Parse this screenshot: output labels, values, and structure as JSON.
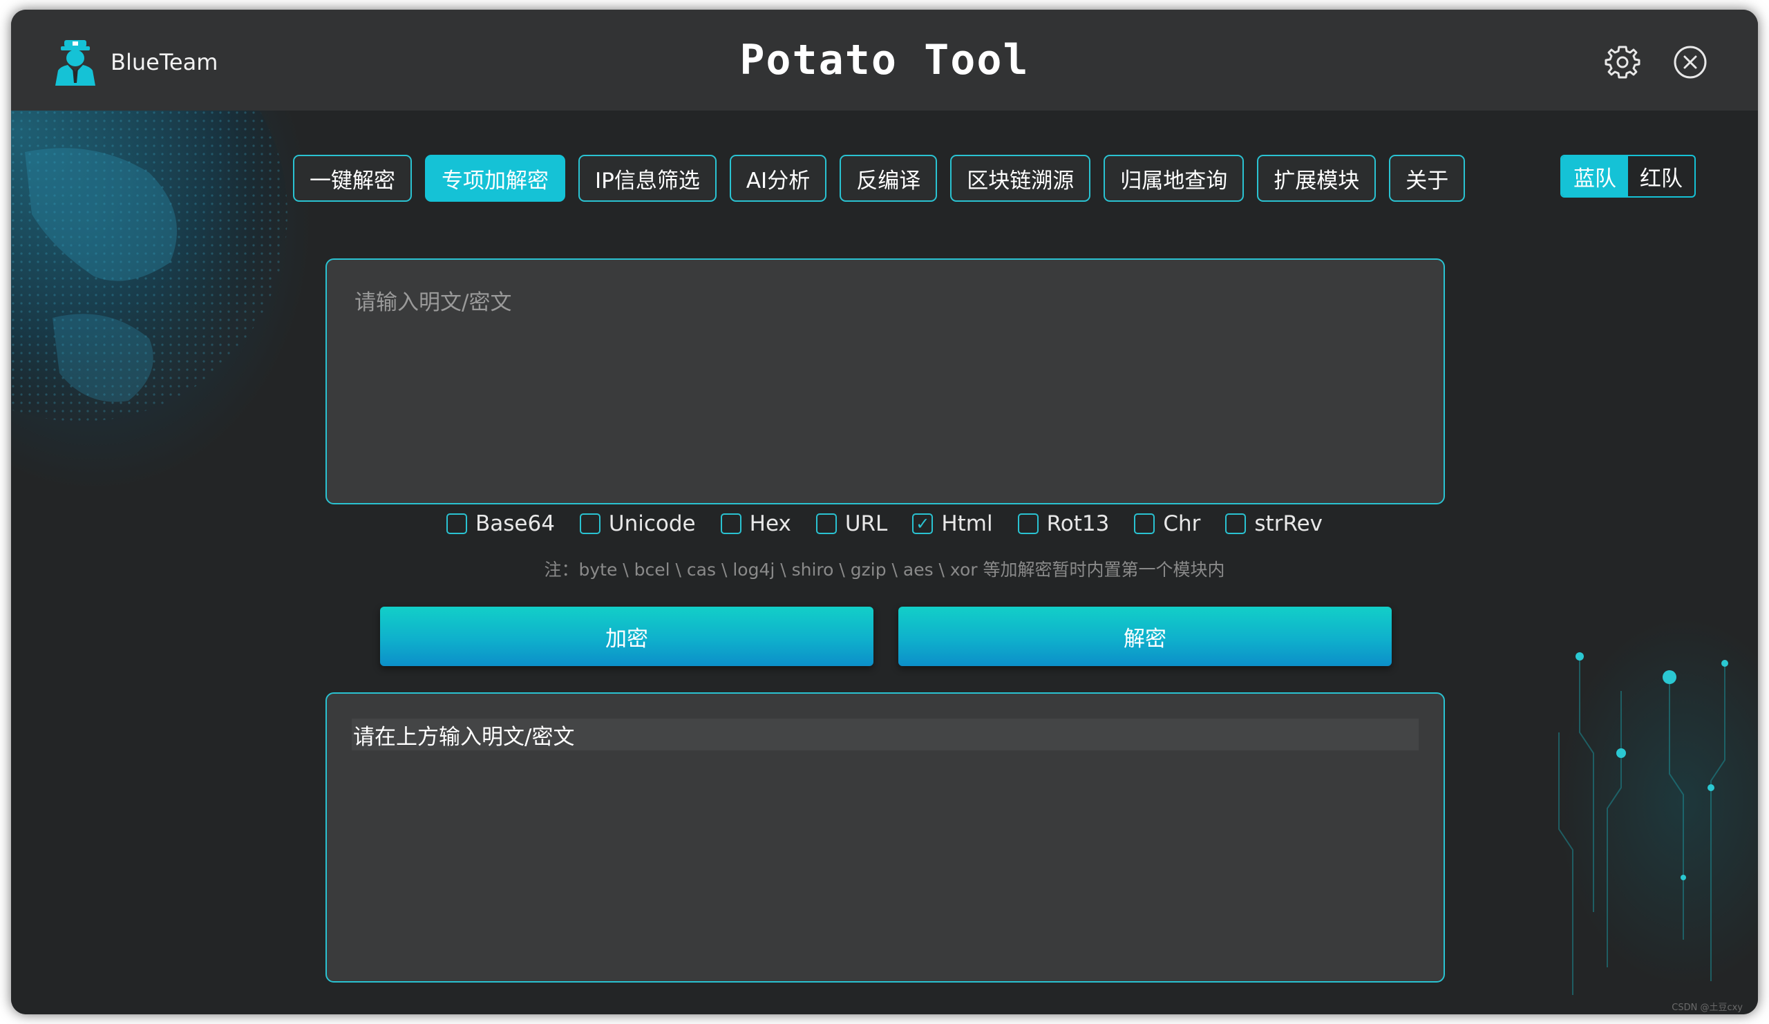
{
  "app": {
    "brand_name": "BlueTeam",
    "title": "Potato Tool",
    "icons": {
      "brand": "officer-avatar-icon",
      "settings": "gear-icon",
      "close": "close-circle-icon"
    }
  },
  "nav": {
    "tabs": [
      {
        "label": "一键解密",
        "active": false
      },
      {
        "label": "专项加解密",
        "active": true
      },
      {
        "label": "IP信息筛选",
        "active": false
      },
      {
        "label": "AI分析",
        "active": false
      },
      {
        "label": "反编译",
        "active": false
      },
      {
        "label": "区块链溯源",
        "active": false
      },
      {
        "label": "归属地查询",
        "active": false
      },
      {
        "label": "扩展模块",
        "active": false
      },
      {
        "label": "关于",
        "active": false
      }
    ]
  },
  "team_toggle": {
    "blue": "蓝队",
    "red": "红队",
    "selected": "blue"
  },
  "input": {
    "placeholder": "请输入明文/密文",
    "value": ""
  },
  "options": [
    {
      "label": "Base64",
      "checked": false
    },
    {
      "label": "Unicode",
      "checked": false
    },
    {
      "label": "Hex",
      "checked": false
    },
    {
      "label": "URL",
      "checked": false
    },
    {
      "label": "Html",
      "checked": true
    },
    {
      "label": "Rot13",
      "checked": false
    },
    {
      "label": "Chr",
      "checked": false
    },
    {
      "label": "strRev",
      "checked": false
    }
  ],
  "note": "注：byte \\ bcel \\ cas \\ log4j \\ shiro \\ gzip \\ aes \\ xor 等加解密暂时内置第一个模块内",
  "buttons": {
    "encrypt": "加密",
    "decrypt": "解密"
  },
  "output": {
    "text": "请在上方输入明文/密文"
  },
  "watermark": "CSDN @土豆cxy",
  "colors": {
    "accent": "#15c2d6",
    "window_bg": "#262728",
    "titlebar_bg": "#323334",
    "panel_bg": "#3a3b3c"
  }
}
